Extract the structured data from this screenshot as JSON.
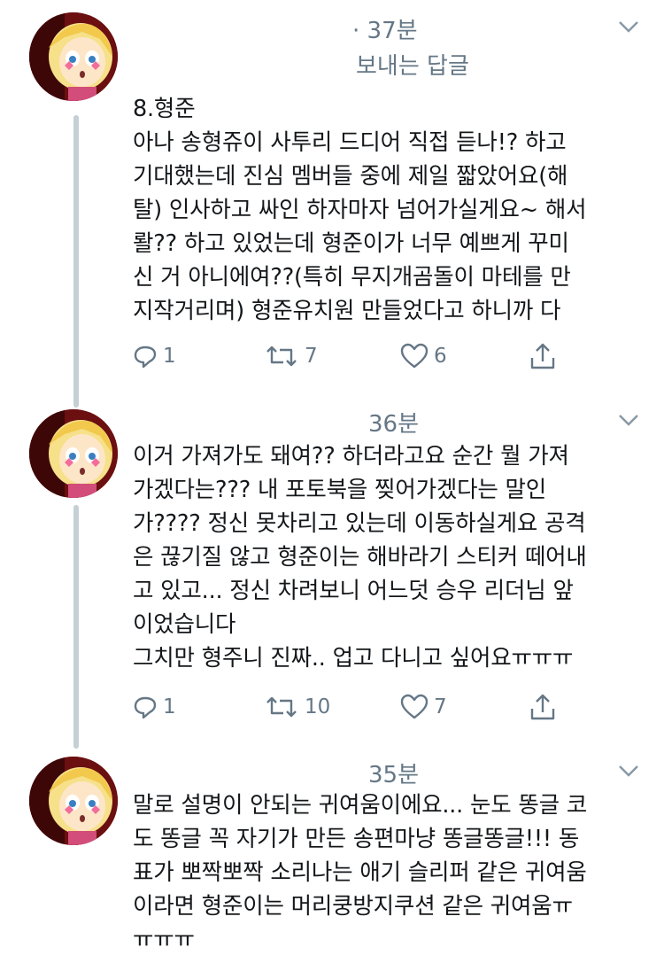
{
  "colors": {
    "text": "#14171a",
    "meta": "#657786",
    "thread_line": "#c4cfd6",
    "background": "#ffffff"
  },
  "tweets": [
    {
      "time": "· 37분",
      "reply_label": "보내는 답글",
      "text": "8.형준\n아나 송형쥬이 사투리 드디어 직접 듣나!? 하고\n기대했는데 진심 멤버들 중에 제일 짧았어요(해\n탈) 인사하고 싸인 하자마자 넘어가실게요~ 해서\n뢀?? 하고 있었는데 형준이가 너무 예쁘게 꾸미\n신 거 아니에여??(특히 무지개곰돌이 마테를 만\n지작거리며) 형준유치원 만들었다고 하니까 다",
      "replies": "1",
      "retweets": "7",
      "likes": "6"
    },
    {
      "time": "36분",
      "text": "이거 가져가도 돼여?? 하더라고요 순간 뭘 가져\n가겠다는??? 내 포토북을 찢어가겠다는 말인\n가???? 정신 못차리고 있는데 이동하실게요 공격\n은 끊기질 않고 형준이는 해바라기 스티커 떼어내\n고 있고... 정신 차려보니 어느덧 승우 리더님 앞\n이었습니다\n그치만 형주니 진짜.. 업고 다니고 싶어요ㅠㅠㅠ",
      "replies": "1",
      "retweets": "10",
      "likes": "7"
    },
    {
      "time": "35분",
      "text": "말로 설명이 안되는 귀여움이에요... 눈도 똥글 코\n도 똥글 꼭 자기가 만든 송편마냥 똥글똥글!!! 동\n표가 뽀짝뽀짝 소리나는 애기 슬리퍼 같은 귀여움\n이라면 형준이는 머리쿵방지쿠션 같은 귀여움ㅠ\nㅠㅠㅠ"
    }
  ]
}
